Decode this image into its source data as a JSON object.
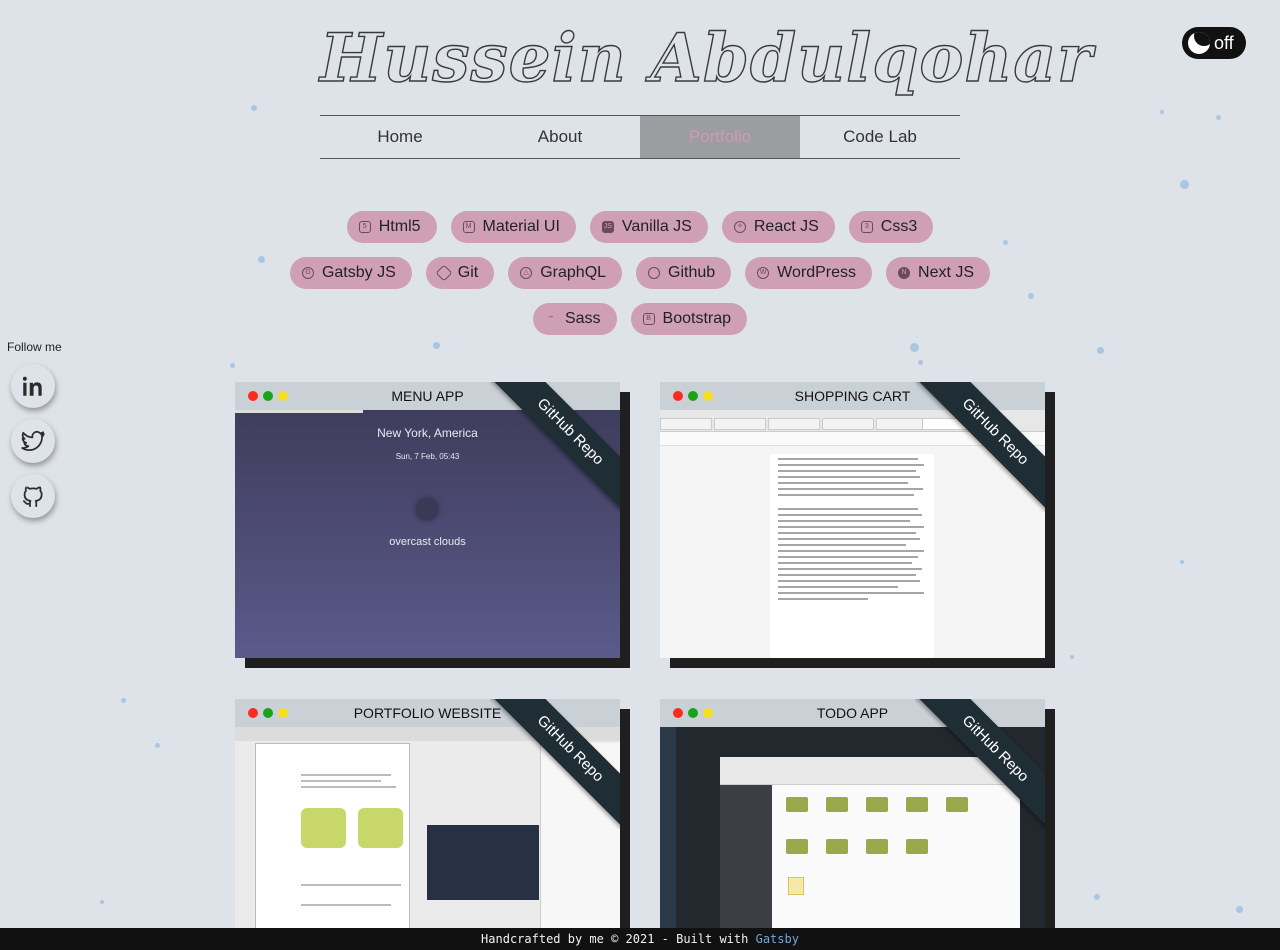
{
  "site": {
    "logo_text": "Hussein Abdulqohar"
  },
  "theme_toggle": {
    "label": "off",
    "icon": "moon-icon"
  },
  "nav": {
    "items": [
      {
        "label": "Home"
      },
      {
        "label": "About"
      },
      {
        "label": "Portfolio",
        "active": true
      },
      {
        "label": "Code Lab"
      }
    ]
  },
  "skills": [
    {
      "label": "Html5",
      "icon": "html5-icon"
    },
    {
      "label": "Material UI",
      "icon": "material-ui-icon"
    },
    {
      "label": "Vanilla JS",
      "icon": "js-icon"
    },
    {
      "label": "React JS",
      "icon": "react-icon"
    },
    {
      "label": "Css3",
      "icon": "css3-icon"
    },
    {
      "label": "Gatsby JS",
      "icon": "gatsby-icon"
    },
    {
      "label": "Git",
      "icon": "git-icon"
    },
    {
      "label": "GraphQL",
      "icon": "graphql-icon"
    },
    {
      "label": "Github",
      "icon": "github-icon"
    },
    {
      "label": "WordPress",
      "icon": "wordpress-icon"
    },
    {
      "label": "Next JS",
      "icon": "nextjs-icon"
    },
    {
      "label": "Sass",
      "icon": "sass-icon"
    },
    {
      "label": "Bootstrap",
      "icon": "bootstrap-icon"
    }
  ],
  "social": {
    "heading": "Follow me",
    "links": [
      {
        "name": "linkedin-icon"
      },
      {
        "name": "twitter-icon"
      },
      {
        "name": "github-icon"
      }
    ]
  },
  "projects": [
    {
      "title": "MENU APP",
      "ribbon": "GitHub Repo",
      "preview": {
        "city": "New York, America",
        "date": "Sun, 7 Feb, 05:43",
        "weather": "overcast clouds"
      }
    },
    {
      "title": "SHOPPING CART",
      "ribbon": "GitHub Repo"
    },
    {
      "title": "PORTFOLIO WEBSITE",
      "ribbon": "GitHub Repo"
    },
    {
      "title": "TODO APP",
      "ribbon": "GitHub Repo"
    }
  ],
  "footer": {
    "text": "Handcrafted by me © 2021 - Built with",
    "link": "Gatsby",
    "link_color": "#6fa8dc"
  },
  "colors": {
    "background": "#dee3e9",
    "chip": "#cf9fb8",
    "active_nav_bg": "#9b9da1",
    "active_nav_text": "#cc9bb8",
    "ribbon": "#1f2d35",
    "traffic_red": "#ff2a1f",
    "traffic_green": "#1aa31a",
    "traffic_yellow": "#f4e020"
  }
}
